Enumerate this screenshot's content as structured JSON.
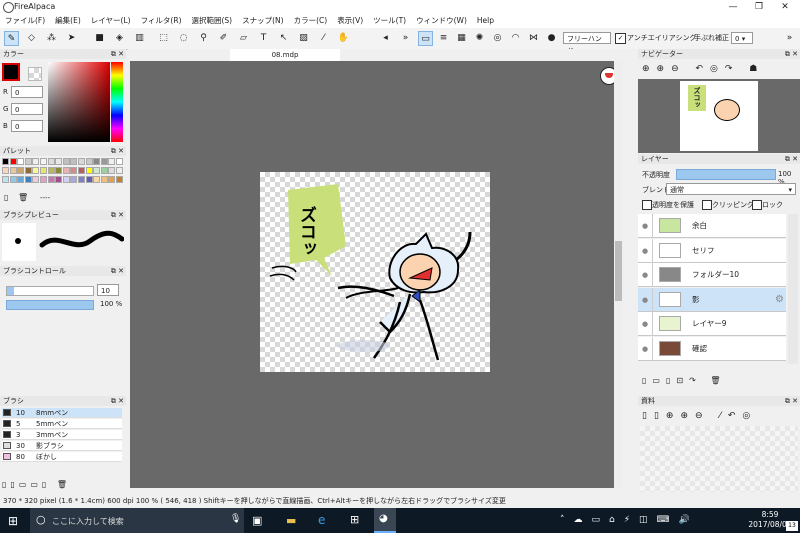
{
  "window": {
    "title": "FireAlpaca",
    "min": "—",
    "max": "❐",
    "close": "✕"
  },
  "menu": [
    "ファイル(F)",
    "編集(E)",
    "レイヤー(L)",
    "フィルタ(R)",
    "選択範囲(S)",
    "スナップ(N)",
    "カラー(C)",
    "表示(V)",
    "ツール(T)",
    "ウィンドウ(W)",
    "Help"
  ],
  "toolbar": {
    "mode_select": "フリーハンド",
    "antialias_label": "アンチエイリアシング",
    "correction_label": "手ぶれ補正",
    "correction_value": "0",
    "more": "»"
  },
  "color_panel": {
    "title": "カラー",
    "r_label": "R",
    "g_label": "G",
    "b_label": "B",
    "r": "0",
    "g": "0",
    "b": "0"
  },
  "palette_panel": {
    "title": "パレット",
    "placeholder": "----",
    "swatches": [
      "#000000",
      "#ff0000",
      "#ffffff",
      "#cccccc",
      "#eeeeee",
      "#f5f5f5",
      "#dddddd",
      "#e8e8e8",
      "#c0c0c0",
      "#bfbfbf",
      "#d9d9d9",
      "#c8c8c8",
      "#888888",
      "#999999",
      "#f0f0f0",
      "#ffffff",
      "#f4d7c0",
      "#e8c79a",
      "#c9a46b",
      "#8b6d3a",
      "#f7f79a",
      "#e6e66b",
      "#b8b85a",
      "#8a8a3a",
      "#e8b3b3",
      "#d28a8a",
      "#b36060",
      "#ffff00",
      "#cfe9cf",
      "#9ecf9e",
      "#dddddd",
      "#eeeeee",
      "#c0e0f0",
      "#90c8e8",
      "#6aa8d8",
      "#4080c0",
      "#f0c8e0",
      "#e0a0c8",
      "#c878b0",
      "#a05090",
      "#d0d0f0",
      "#a8a8e0",
      "#8080c8",
      "#6060b0",
      "#f8d8a8",
      "#f0c080",
      "#e0a050",
      "#c08030"
    ]
  },
  "brush_preview_panel": {
    "title": "ブラシプレビュー"
  },
  "brush_control_panel": {
    "title": "ブラシコントロール",
    "size": "10",
    "opacity": "100 %"
  },
  "brush_panel": {
    "title": "ブラシ",
    "items": [
      {
        "size": "10",
        "name": "8mmペン",
        "color": "#222222"
      },
      {
        "size": "5",
        "name": "5mmペン",
        "color": "#222222"
      },
      {
        "size": "3",
        "name": "3mmペン",
        "color": "#222222"
      },
      {
        "size": "30",
        "name": "影ブラシ",
        "color": "#dddddd"
      },
      {
        "size": "80",
        "name": "ぼかし",
        "color": "#f0c0e0"
      }
    ]
  },
  "document": {
    "tab": "08.mdp",
    "speech": "ズコッ"
  },
  "navigator_panel": {
    "title": "ナビゲーター",
    "speech": "ズコッ"
  },
  "layer_panel": {
    "title": "レイヤー",
    "opacity_label": "不透明度",
    "opacity_value": "100 %",
    "blend_label": "ブレンド",
    "blend_value": "通常",
    "protect_label": "透明度を保護",
    "clipping_label": "クリッピング",
    "lock_label": "ロック",
    "layers": [
      {
        "name": "余白",
        "color": "#c8e6a0",
        "active": false
      },
      {
        "name": "セリフ",
        "color": "#ffffff",
        "active": false
      },
      {
        "name": "フォルダー10",
        "color": "#888888",
        "active": false
      },
      {
        "name": "影",
        "color": "#ffffff",
        "active": true
      },
      {
        "name": "レイヤー9",
        "color": "#e8f4d0",
        "active": false
      },
      {
        "name": "確認",
        "color": "#7a4a38",
        "active": false
      }
    ]
  },
  "material_panel": {
    "title": "資料"
  },
  "status": {
    "text": "370 * 320 pixel   (1.6 * 1.4cm)   600 dpi   100 %   ( 546, 418 )   Shiftキーを押しながらで直線描画、Ctrl+Altキーを押しながら左右ドラッグでブラシサイズ変更"
  },
  "taskbar": {
    "search_placeholder": "ここに入力して検索",
    "time": "8:59",
    "date": "2017/08/07",
    "notif": "13"
  }
}
